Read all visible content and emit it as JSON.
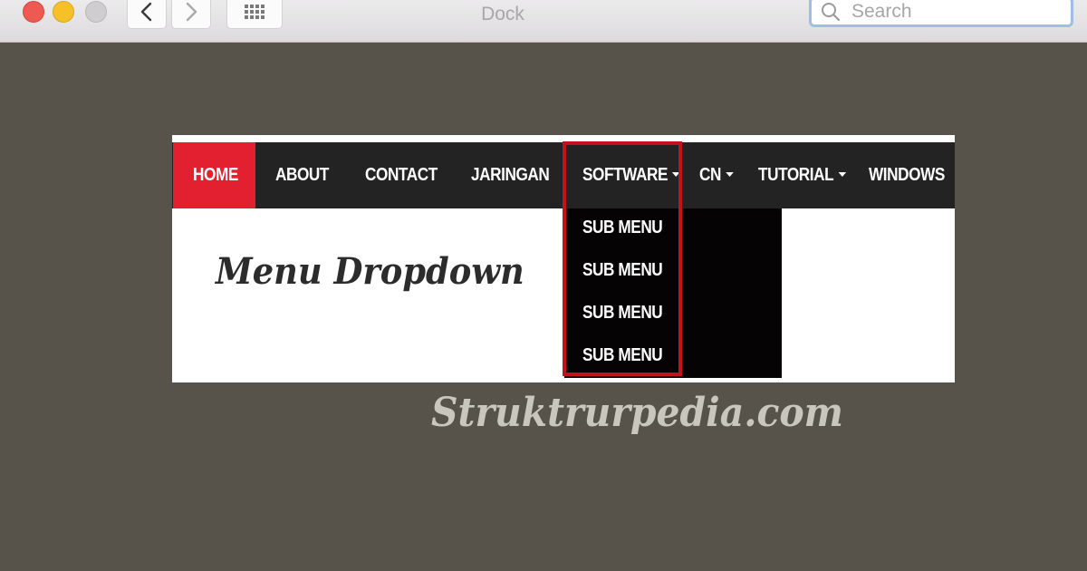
{
  "window": {
    "title": "Dock",
    "search_placeholder": "Search"
  },
  "menu": {
    "items": [
      {
        "label": "HOME",
        "active": true
      },
      {
        "label": "ABOUT"
      },
      {
        "label": "CONTACT"
      },
      {
        "label": "JARINGAN"
      },
      {
        "label": "SOFTWARE",
        "has_dropdown": true
      },
      {
        "label": "CN",
        "has_dropdown": true
      },
      {
        "label": "TUTORIAL",
        "has_dropdown": true
      },
      {
        "label": "WINDOWS"
      }
    ],
    "submenu": [
      "SUB MENU",
      "SUB MENU",
      "SUB MENU",
      "SUB MENU"
    ]
  },
  "content": {
    "title": "Menu Dropdown",
    "watermark": "Struktrurpedia.com"
  },
  "colors": {
    "background": "#57534a",
    "menu_bar": "#232323",
    "home_active": "#e32030",
    "dropdown": "#050304",
    "highlight_border": "#c4121c"
  },
  "icons": [
    "back-arrow-icon",
    "forward-arrow-icon",
    "grid-icon",
    "search-icon"
  ]
}
